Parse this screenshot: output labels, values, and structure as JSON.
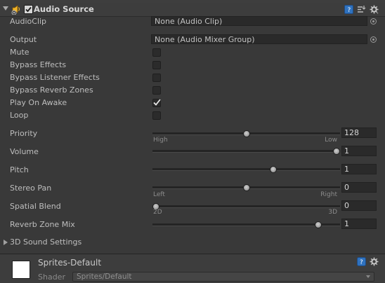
{
  "header": {
    "title": "Audio Source",
    "enabled": true,
    "icons": [
      "speaker-icon",
      "book-icon",
      "preset-icon",
      "gear-icon"
    ]
  },
  "fields": {
    "audio_clip": {
      "label": "AudioClip",
      "value": "None (Audio Clip)"
    },
    "output": {
      "label": "Output",
      "value": "None (Audio Mixer Group)"
    },
    "mute": {
      "label": "Mute",
      "checked": false
    },
    "bypass_effects": {
      "label": "Bypass Effects",
      "checked": false
    },
    "bypass_listener_effects": {
      "label": "Bypass Listener Effects",
      "checked": false
    },
    "bypass_reverb_zones": {
      "label": "Bypass Reverb Zones",
      "checked": false
    },
    "play_on_awake": {
      "label": "Play On Awake",
      "checked": true
    },
    "loop": {
      "label": "Loop",
      "checked": false
    }
  },
  "sliders": {
    "priority": {
      "label": "Priority",
      "value": "128",
      "fraction": 0.5,
      "min_label": "High",
      "max_label": "Low"
    },
    "volume": {
      "label": "Volume",
      "value": "1",
      "fraction": 1.0
    },
    "pitch": {
      "label": "Pitch",
      "value": "1",
      "fraction": 0.65
    },
    "stereo_pan": {
      "label": "Stereo Pan",
      "value": "0",
      "fraction": 0.5,
      "min_label": "Left",
      "max_label": "Right"
    },
    "spatial_blend": {
      "label": "Spatial Blend",
      "value": "0",
      "fraction": 0.0,
      "min_label": "2D",
      "max_label": "3D"
    },
    "reverb_zone_mix": {
      "label": "Reverb Zone Mix",
      "value": "1",
      "fraction": 0.9
    }
  },
  "sound_settings": {
    "label": "3D Sound Settings"
  },
  "material": {
    "name": "Sprites-Default",
    "shader_label": "Shader",
    "shader_value": "Sprites/Default"
  },
  "colors": {
    "background": "#393939",
    "field": "#2a2a2a",
    "accent": "#2f72bf",
    "swatch": "#ffffff"
  }
}
